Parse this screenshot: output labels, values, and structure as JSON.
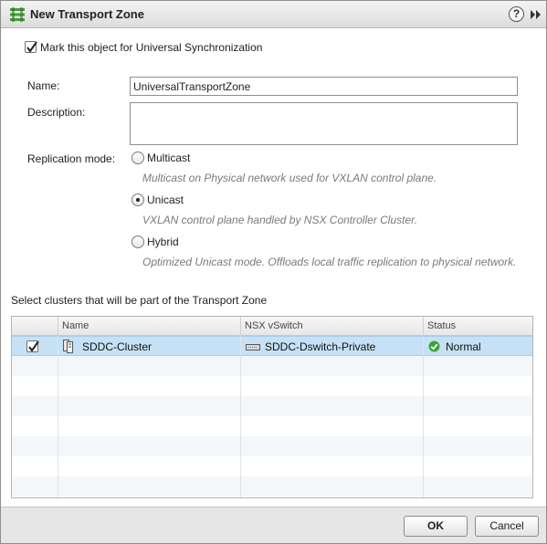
{
  "dialog": {
    "title": "New Transport Zone",
    "help_label": "?",
    "icons": {
      "title": "transport-zone-icon",
      "help": "help-icon",
      "expand": "double-chevron-right-icon"
    }
  },
  "universal_sync": {
    "label": "Mark this object for Universal Synchronization",
    "checked": true
  },
  "form": {
    "name_label": "Name:",
    "name_value": "UniversalTransportZone",
    "description_label": "Description:",
    "description_value": "",
    "replication_label": "Replication mode:",
    "replication_options": [
      {
        "label": "Multicast",
        "hint": "Multicast on Physical network used for VXLAN control plane.",
        "selected": false
      },
      {
        "label": "Unicast",
        "hint": "VXLAN control plane handled by NSX Controller Cluster.",
        "selected": true
      },
      {
        "label": "Hybrid",
        "hint": "Optimized Unicast mode. Offloads local traffic replication to physical network.",
        "selected": false
      }
    ]
  },
  "clusters": {
    "heading": "Select clusters that will be part of the Transport Zone",
    "columns": [
      "Name",
      "NSX vSwitch",
      "Status"
    ],
    "rows": [
      {
        "checked": true,
        "name": "SDDC-Cluster",
        "vswitch": "SDDC-Dswitch-Private",
        "status": "Normal",
        "name_icon": "cluster-icon",
        "vswitch_icon": "dvswitch-icon",
        "status_icon": "check-circle-icon",
        "status_color": "#3aa53a"
      }
    ]
  },
  "footer": {
    "ok_label": "OK",
    "cancel_label": "Cancel"
  },
  "colors": {
    "selected_row": "#c6e1f5",
    "hint_text": "#7a7a7a"
  }
}
